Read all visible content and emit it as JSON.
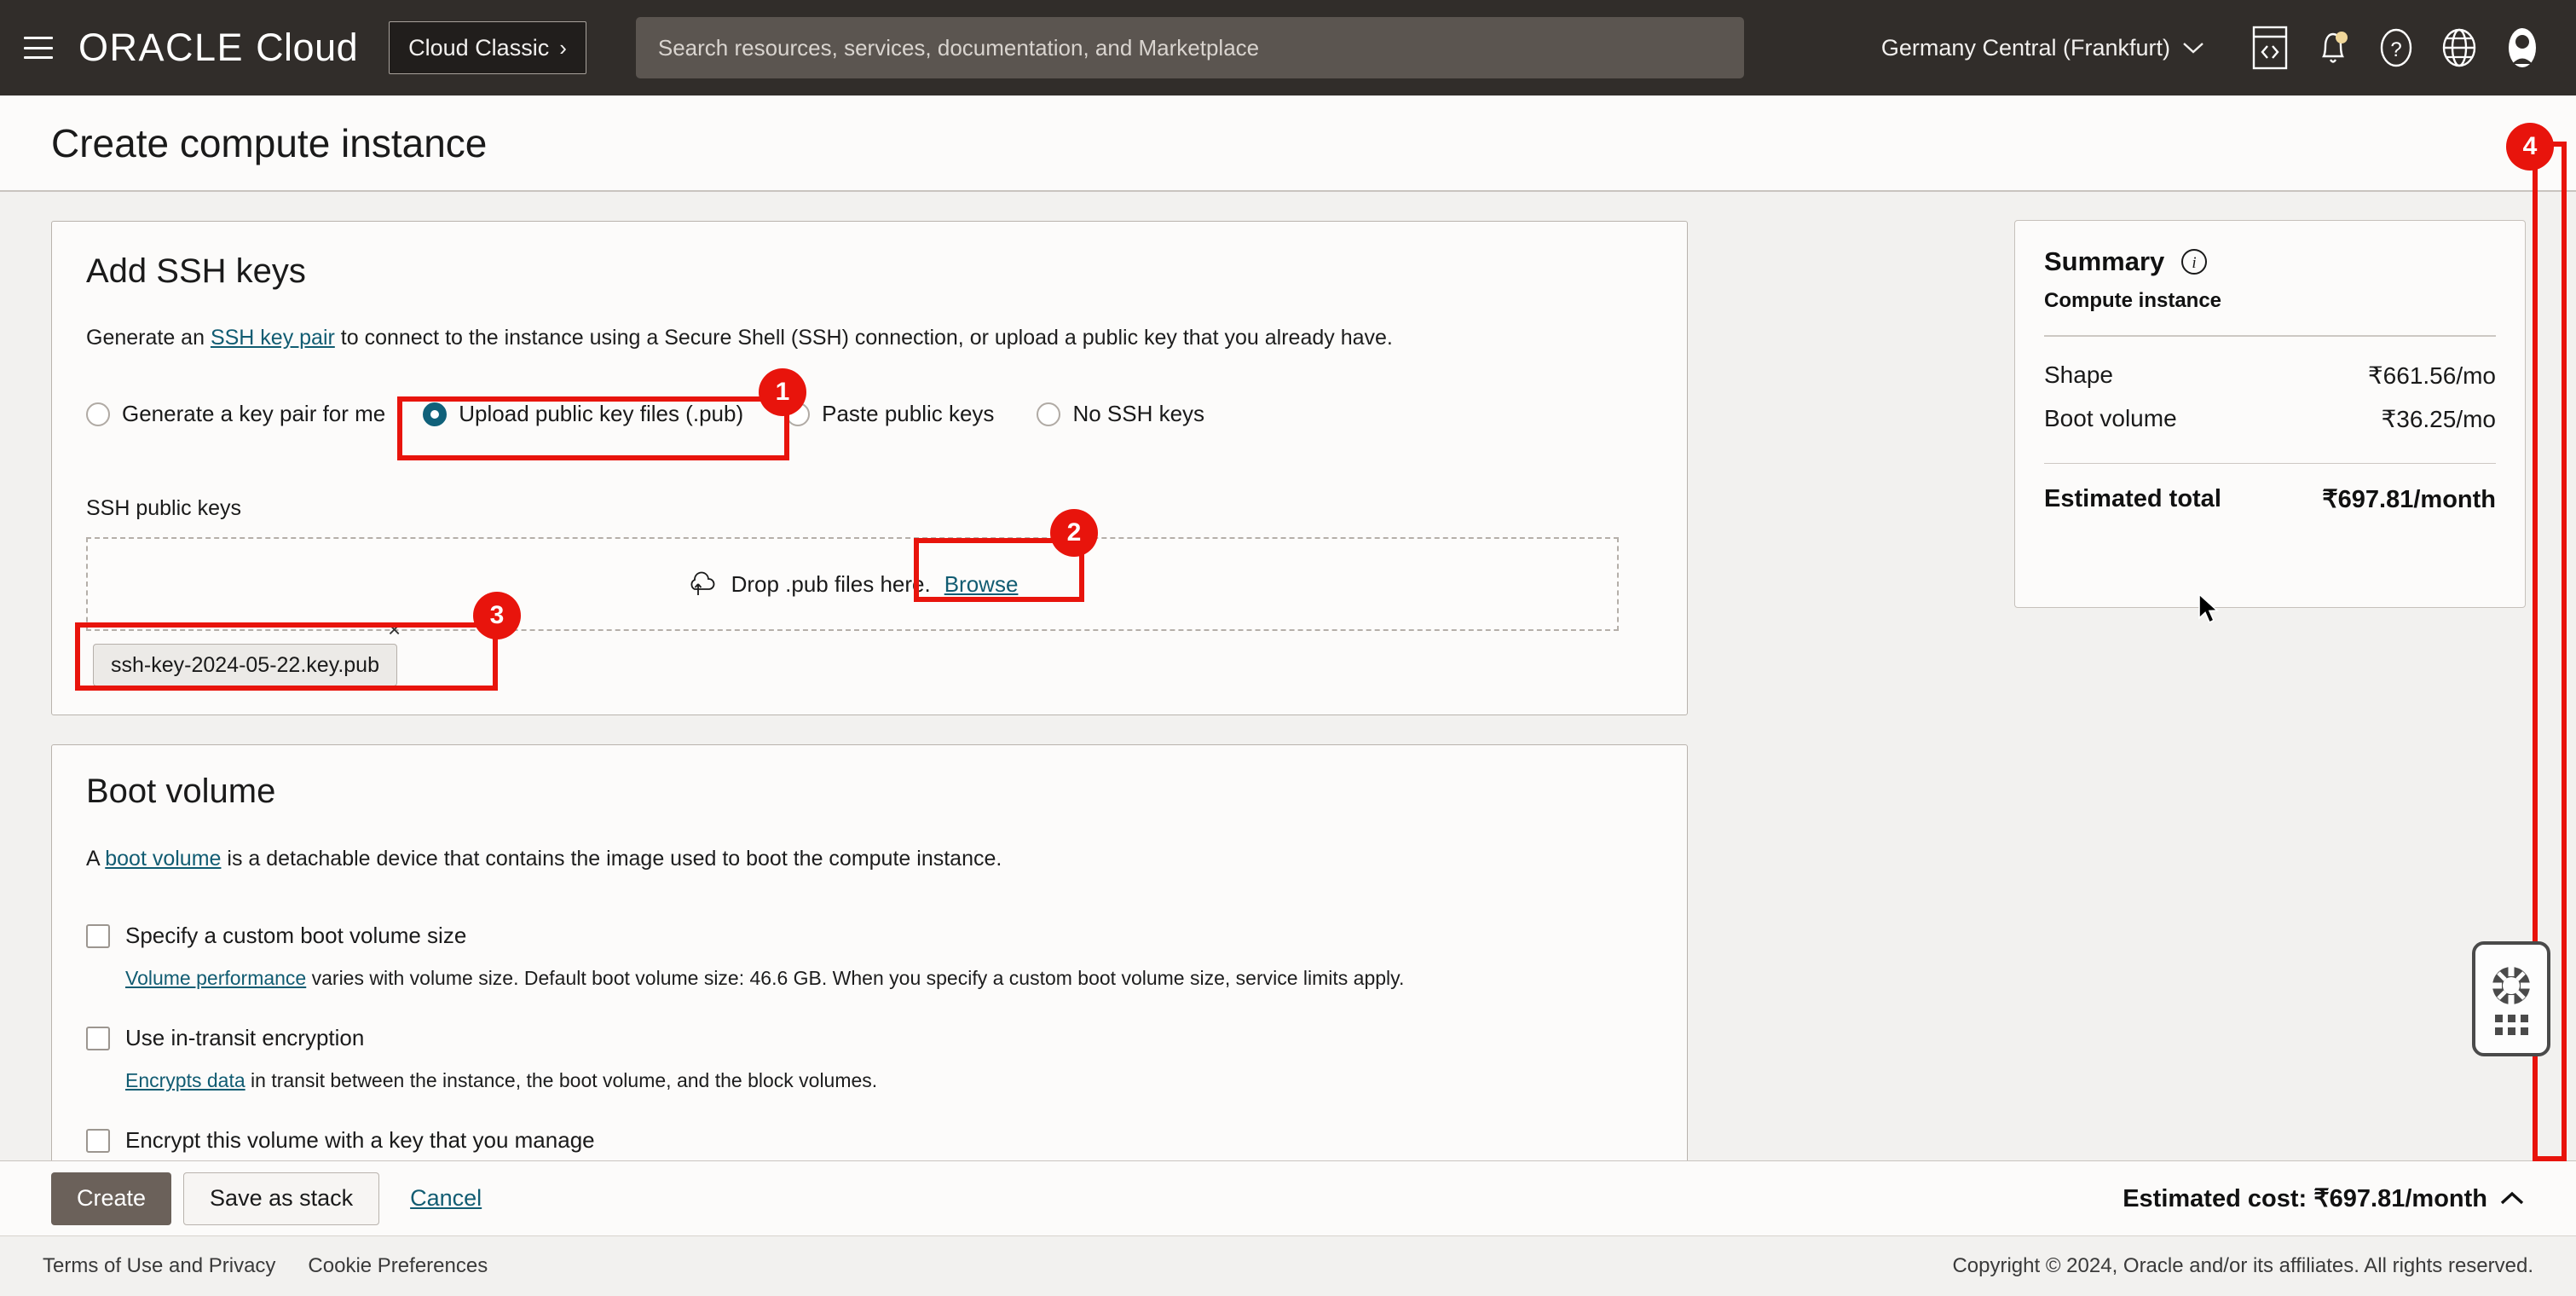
{
  "topnav": {
    "menu_icon": "hamburger-menu-icon",
    "brand_oracle": "ORACLE",
    "brand_cloud": "Cloud",
    "cloud_classic_label": "Cloud Classic",
    "cloud_classic_chevron": "›",
    "search_placeholder": "Search resources, services, documentation, and Marketplace",
    "region": "Germany Central (Frankfurt)",
    "region_chevron": "⌄",
    "icons": [
      "code-editor-icon",
      "notification-bell-icon",
      "help-question-icon",
      "globe-language-icon",
      "user-avatar-icon"
    ]
  },
  "page": {
    "title": "Create compute instance"
  },
  "ssh": {
    "section_title": "Add SSH keys",
    "desc_prefix": "Generate an ",
    "desc_link": "SSH key pair",
    "desc_suffix": " to connect to the instance using a Secure Shell (SSH) connection, or upload a public key that you already have.",
    "options": [
      {
        "label": "Generate a key pair for me",
        "selected": false
      },
      {
        "label": "Upload public key files (.pub)",
        "selected": true
      },
      {
        "label": "Paste public keys",
        "selected": false
      },
      {
        "label": "No SSH keys",
        "selected": false
      }
    ],
    "keys_label": "SSH public keys",
    "dropzone_icon": "cloud-upload-icon",
    "dropzone_text": "Drop .pub files here.",
    "browse_label": "Browse",
    "uploaded_file": "ssh-key-2024-05-22.key.pub",
    "remove_icon": "×"
  },
  "boot": {
    "section_title": "Boot volume",
    "desc_prefix": "A ",
    "desc_link": "boot volume",
    "desc_suffix": " is a detachable device that contains the image used to boot the compute instance.",
    "checkboxes": [
      {
        "label": "Specify a custom boot volume size",
        "checked": false,
        "help_link": "Volume performance",
        "help_text": " varies with volume size. Default boot volume size: 46.6 GB. When you specify a custom boot volume size, service limits apply."
      },
      {
        "label": "Use in-transit encryption",
        "checked": false,
        "help_link": "Encrypts data",
        "help_text": " in transit between the instance, the boot volume, and the block volumes."
      },
      {
        "label": "Encrypt this volume with a key that you manage",
        "checked": false,
        "help_link": "",
        "help_text": ""
      }
    ]
  },
  "summary": {
    "title": "Summary",
    "info_icon": "info-icon",
    "subtitle": "Compute instance",
    "rows": [
      {
        "label": "Shape",
        "value": "₹661.56/mo"
      },
      {
        "label": "Boot volume",
        "value": "₹36.25/mo"
      }
    ],
    "total_label": "Estimated total",
    "total_value": "₹697.81/month"
  },
  "help_widget": {
    "icon": "lifesaver-support-icon",
    "handle": "drag-dots-handle"
  },
  "actionbar": {
    "create_label": "Create",
    "save_stack_label": "Save as stack",
    "cancel_label": "Cancel",
    "estimated_cost": "Estimated cost: ₹697.81/month",
    "collapse_chevron": "⌃"
  },
  "footer": {
    "terms": "Terms of Use and Privacy",
    "cookies": "Cookie Preferences",
    "copyright": "Copyright © 2024, Oracle and/or its affiliates. All rights reserved."
  },
  "annotations": [
    {
      "number": "1",
      "target": "upload-public-key-files-radio"
    },
    {
      "number": "2",
      "target": "browse-link"
    },
    {
      "number": "3",
      "target": "uploaded-file-chip"
    },
    {
      "number": "4",
      "target": "page-scrollbar"
    }
  ],
  "colors": {
    "accent_red": "#e8140c",
    "link_blue": "#115c72",
    "nav_dark": "#312d2a",
    "radio_selected": "#10617a"
  }
}
